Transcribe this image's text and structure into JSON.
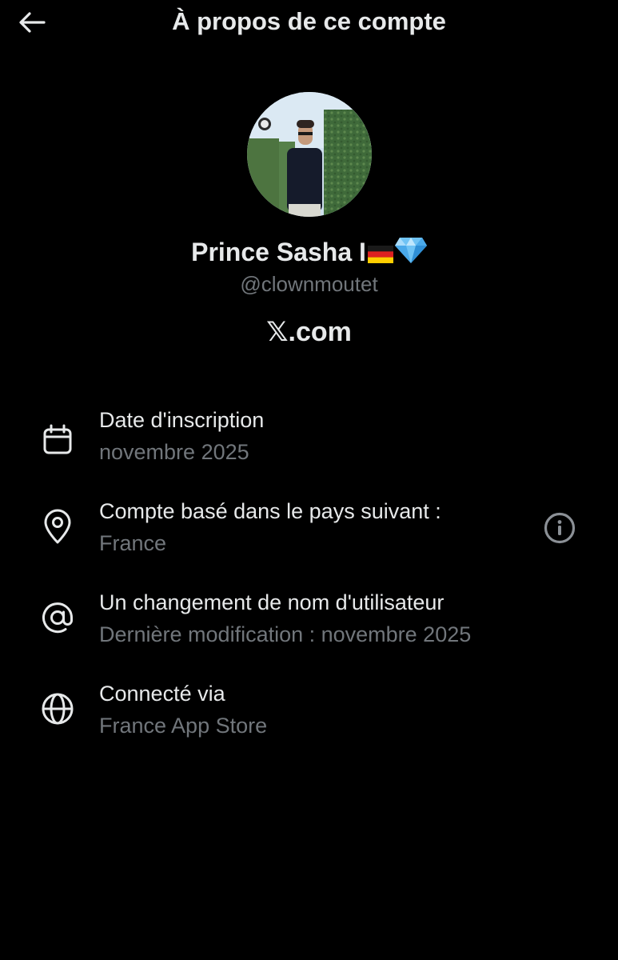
{
  "header": {
    "title": "À propos de ce compte",
    "back_icon": "arrow-left-icon"
  },
  "profile": {
    "display_name": "Prince Sasha I",
    "badges": [
      "germany-flag-emoji",
      "gem-emoji"
    ],
    "handle": "@clownmoutet",
    "site": "𝕏.com"
  },
  "details": [
    {
      "icon": "calendar-icon",
      "title": "Date d'inscription",
      "subtitle": "novembre 2025"
    },
    {
      "icon": "location-pin-icon",
      "title": "Compte basé dans le pays suivant :",
      "subtitle": "France",
      "action_icon": "info-icon"
    },
    {
      "icon": "at-sign-icon",
      "title": "Un changement de nom d'utilisateur",
      "subtitle": "Dernière modification : novembre 2025"
    },
    {
      "icon": "globe-icon",
      "title": "Connecté via",
      "subtitle": "France App Store"
    }
  ],
  "colors": {
    "background": "#000000",
    "primary_text": "#e7e9ea",
    "secondary_text": "#71767b"
  }
}
